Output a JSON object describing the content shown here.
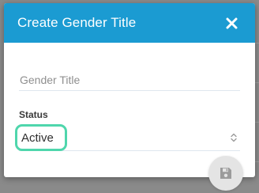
{
  "dialog": {
    "title": "Create Gender Title",
    "close_icon": "close-icon"
  },
  "form": {
    "gender_title": {
      "placeholder": "Gender Title",
      "value": ""
    },
    "status": {
      "label": "Status",
      "selected": "Active",
      "icon": "select-arrows-icon"
    }
  },
  "actions": {
    "save_icon": "floppy-disk-icon"
  },
  "colors": {
    "header": "#1b9bd2",
    "highlight": "#4fd6ac",
    "overlay": "#8a8a8a"
  }
}
